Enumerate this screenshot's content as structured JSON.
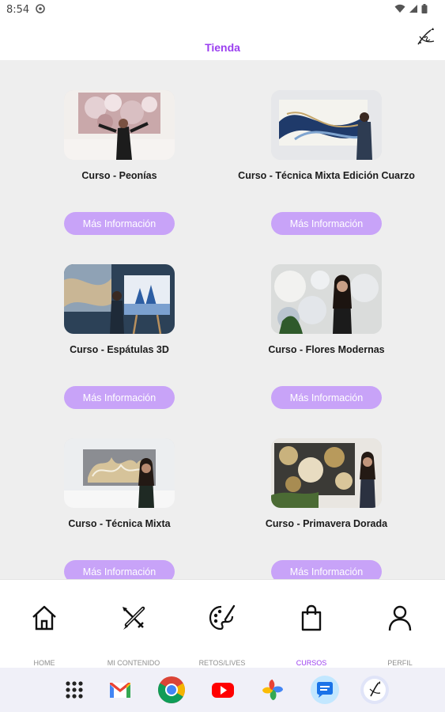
{
  "status_bar": {
    "time": "8:54"
  },
  "header": {
    "title": "Tienda",
    "logo_icon": "artist-logo-icon"
  },
  "products": [
    {
      "title": "Curso - Peonías",
      "button_label": "Más Información"
    },
    {
      "title": "Curso - Técnica Mixta Edición Cuarzo",
      "button_label": "Más Información"
    },
    {
      "title": "Curso - Espátulas 3D",
      "button_label": "Más Información"
    },
    {
      "title": "Curso - Flores Modernas",
      "button_label": "Más Información"
    },
    {
      "title": "Curso - Técnica Mixta",
      "button_label": "Más Información"
    },
    {
      "title": "Curso - Primavera Dorada",
      "button_label": "Más Información"
    }
  ],
  "bottom_nav": [
    {
      "label": "HOME",
      "icon": "home-icon",
      "active": false
    },
    {
      "label": "MI CONTENIDO",
      "icon": "brush-pencil-icon",
      "active": false
    },
    {
      "label": "RETOS/LIVES",
      "icon": "palette-icon",
      "active": false
    },
    {
      "label": "CURSOS",
      "icon": "shopping-bag-icon",
      "active": true
    },
    {
      "label": "PERFIL",
      "icon": "person-icon",
      "active": false
    }
  ],
  "taskbar": [
    "app-drawer-icon",
    "gmail-icon",
    "chrome-icon",
    "youtube-icon",
    "photos-icon",
    "messages-icon",
    "app-icon"
  ],
  "colors": {
    "accent": "#9b3ff0",
    "button_bg": "#c8a3f8",
    "content_bg": "#eeeeee"
  }
}
